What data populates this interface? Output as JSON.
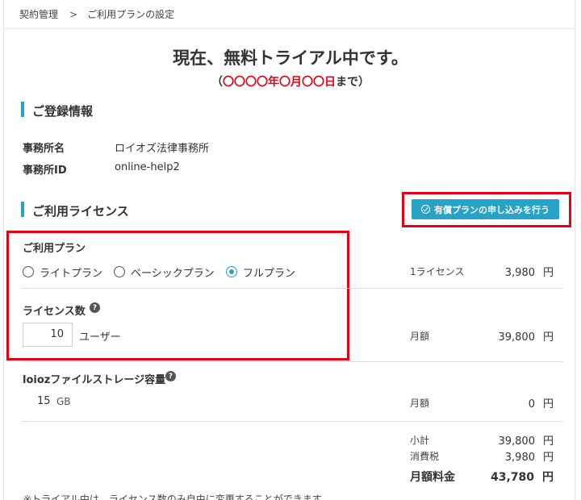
{
  "breadcrumb": {
    "root": "契約管理",
    "separator": ">",
    "current": "ご利用プランの設定"
  },
  "header": {
    "title": "現在、無料トライアル中です。",
    "subtitle_open": "（",
    "subtitle_date": "〇〇〇〇年〇月〇〇日",
    "subtitle_close": "まで）"
  },
  "registration": {
    "section_title": "ご登録情報",
    "office_name_label": "事務所名",
    "office_name_value": "ロイオズ法律事務所",
    "office_id_label": "事務所ID",
    "office_id_value": "online-help2"
  },
  "license": {
    "section_title": "ご利用ライセンス",
    "apply_button": "有償プランの申し込みを行う",
    "plan_label": "ご利用プラン",
    "plans": [
      {
        "label": "ライトプラン",
        "selected": false
      },
      {
        "label": "ベーシックプラン",
        "selected": false
      },
      {
        "label": "フルプラン",
        "selected": true
      }
    ],
    "unit_price_label": "1ライセンス",
    "unit_price_value": "3,980",
    "count_label": "ライセンス数",
    "count_value": "10",
    "count_unit": "ユーザー",
    "monthly_label": "月額",
    "monthly_value": "39,800",
    "help_glyph": "?"
  },
  "storage": {
    "label": "loiozファイルストレージ容量",
    "value": "15",
    "unit": "GB",
    "monthly_label": "月額",
    "monthly_value": "0"
  },
  "totals": {
    "subtotal_label": "小計",
    "subtotal_value": "39,800",
    "tax_label": "消費税",
    "tax_value": "3,980",
    "total_label": "月額料金",
    "total_value": "43,780"
  },
  "currency": "円",
  "footnote": "※トライアル中は、ライセンス数のみ自由に変更することができます。",
  "colors": {
    "accent": "#27a3c7",
    "highlight_red": "#e60012"
  }
}
